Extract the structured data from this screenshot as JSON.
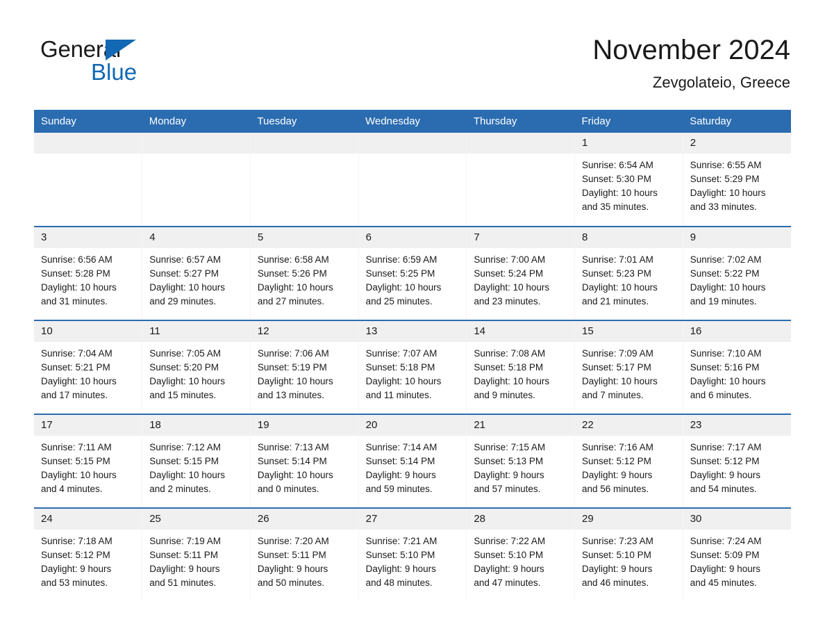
{
  "brand": {
    "word_one": "General",
    "word_two": "Blue",
    "triangle_color": "#1268b3",
    "text_color": "#1a1a1a"
  },
  "header": {
    "month_title": "November 2024",
    "location": "Zevgolateio, Greece"
  },
  "theme": {
    "header_blue": "#2b6cb0",
    "daynum_band": "#f0f0f0",
    "page_background": "#ffffff"
  },
  "calendar": {
    "weekday_headers": [
      "Sunday",
      "Monday",
      "Tuesday",
      "Wednesday",
      "Thursday",
      "Friday",
      "Saturday"
    ],
    "weeks": [
      [
        {
          "day": "",
          "lines": []
        },
        {
          "day": "",
          "lines": []
        },
        {
          "day": "",
          "lines": []
        },
        {
          "day": "",
          "lines": []
        },
        {
          "day": "",
          "lines": []
        },
        {
          "day": "1",
          "lines": [
            "Sunrise: 6:54 AM",
            "Sunset: 5:30 PM",
            "Daylight: 10 hours",
            "and 35 minutes."
          ]
        },
        {
          "day": "2",
          "lines": [
            "Sunrise: 6:55 AM",
            "Sunset: 5:29 PM",
            "Daylight: 10 hours",
            "and 33 minutes."
          ]
        }
      ],
      [
        {
          "day": "3",
          "lines": [
            "Sunrise: 6:56 AM",
            "Sunset: 5:28 PM",
            "Daylight: 10 hours",
            "and 31 minutes."
          ]
        },
        {
          "day": "4",
          "lines": [
            "Sunrise: 6:57 AM",
            "Sunset: 5:27 PM",
            "Daylight: 10 hours",
            "and 29 minutes."
          ]
        },
        {
          "day": "5",
          "lines": [
            "Sunrise: 6:58 AM",
            "Sunset: 5:26 PM",
            "Daylight: 10 hours",
            "and 27 minutes."
          ]
        },
        {
          "day": "6",
          "lines": [
            "Sunrise: 6:59 AM",
            "Sunset: 5:25 PM",
            "Daylight: 10 hours",
            "and 25 minutes."
          ]
        },
        {
          "day": "7",
          "lines": [
            "Sunrise: 7:00 AM",
            "Sunset: 5:24 PM",
            "Daylight: 10 hours",
            "and 23 minutes."
          ]
        },
        {
          "day": "8",
          "lines": [
            "Sunrise: 7:01 AM",
            "Sunset: 5:23 PM",
            "Daylight: 10 hours",
            "and 21 minutes."
          ]
        },
        {
          "day": "9",
          "lines": [
            "Sunrise: 7:02 AM",
            "Sunset: 5:22 PM",
            "Daylight: 10 hours",
            "and 19 minutes."
          ]
        }
      ],
      [
        {
          "day": "10",
          "lines": [
            "Sunrise: 7:04 AM",
            "Sunset: 5:21 PM",
            "Daylight: 10 hours",
            "and 17 minutes."
          ]
        },
        {
          "day": "11",
          "lines": [
            "Sunrise: 7:05 AM",
            "Sunset: 5:20 PM",
            "Daylight: 10 hours",
            "and 15 minutes."
          ]
        },
        {
          "day": "12",
          "lines": [
            "Sunrise: 7:06 AM",
            "Sunset: 5:19 PM",
            "Daylight: 10 hours",
            "and 13 minutes."
          ]
        },
        {
          "day": "13",
          "lines": [
            "Sunrise: 7:07 AM",
            "Sunset: 5:18 PM",
            "Daylight: 10 hours",
            "and 11 minutes."
          ]
        },
        {
          "day": "14",
          "lines": [
            "Sunrise: 7:08 AM",
            "Sunset: 5:18 PM",
            "Daylight: 10 hours",
            "and 9 minutes."
          ]
        },
        {
          "day": "15",
          "lines": [
            "Sunrise: 7:09 AM",
            "Sunset: 5:17 PM",
            "Daylight: 10 hours",
            "and 7 minutes."
          ]
        },
        {
          "day": "16",
          "lines": [
            "Sunrise: 7:10 AM",
            "Sunset: 5:16 PM",
            "Daylight: 10 hours",
            "and 6 minutes."
          ]
        }
      ],
      [
        {
          "day": "17",
          "lines": [
            "Sunrise: 7:11 AM",
            "Sunset: 5:15 PM",
            "Daylight: 10 hours",
            "and 4 minutes."
          ]
        },
        {
          "day": "18",
          "lines": [
            "Sunrise: 7:12 AM",
            "Sunset: 5:15 PM",
            "Daylight: 10 hours",
            "and 2 minutes."
          ]
        },
        {
          "day": "19",
          "lines": [
            "Sunrise: 7:13 AM",
            "Sunset: 5:14 PM",
            "Daylight: 10 hours",
            "and 0 minutes."
          ]
        },
        {
          "day": "20",
          "lines": [
            "Sunrise: 7:14 AM",
            "Sunset: 5:14 PM",
            "Daylight: 9 hours",
            "and 59 minutes."
          ]
        },
        {
          "day": "21",
          "lines": [
            "Sunrise: 7:15 AM",
            "Sunset: 5:13 PM",
            "Daylight: 9 hours",
            "and 57 minutes."
          ]
        },
        {
          "day": "22",
          "lines": [
            "Sunrise: 7:16 AM",
            "Sunset: 5:12 PM",
            "Daylight: 9 hours",
            "and 56 minutes."
          ]
        },
        {
          "day": "23",
          "lines": [
            "Sunrise: 7:17 AM",
            "Sunset: 5:12 PM",
            "Daylight: 9 hours",
            "and 54 minutes."
          ]
        }
      ],
      [
        {
          "day": "24",
          "lines": [
            "Sunrise: 7:18 AM",
            "Sunset: 5:12 PM",
            "Daylight: 9 hours",
            "and 53 minutes."
          ]
        },
        {
          "day": "25",
          "lines": [
            "Sunrise: 7:19 AM",
            "Sunset: 5:11 PM",
            "Daylight: 9 hours",
            "and 51 minutes."
          ]
        },
        {
          "day": "26",
          "lines": [
            "Sunrise: 7:20 AM",
            "Sunset: 5:11 PM",
            "Daylight: 9 hours",
            "and 50 minutes."
          ]
        },
        {
          "day": "27",
          "lines": [
            "Sunrise: 7:21 AM",
            "Sunset: 5:10 PM",
            "Daylight: 9 hours",
            "and 48 minutes."
          ]
        },
        {
          "day": "28",
          "lines": [
            "Sunrise: 7:22 AM",
            "Sunset: 5:10 PM",
            "Daylight: 9 hours",
            "and 47 minutes."
          ]
        },
        {
          "day": "29",
          "lines": [
            "Sunrise: 7:23 AM",
            "Sunset: 5:10 PM",
            "Daylight: 9 hours",
            "and 46 minutes."
          ]
        },
        {
          "day": "30",
          "lines": [
            "Sunrise: 7:24 AM",
            "Sunset: 5:09 PM",
            "Daylight: 9 hours",
            "and 45 minutes."
          ]
        }
      ]
    ]
  }
}
